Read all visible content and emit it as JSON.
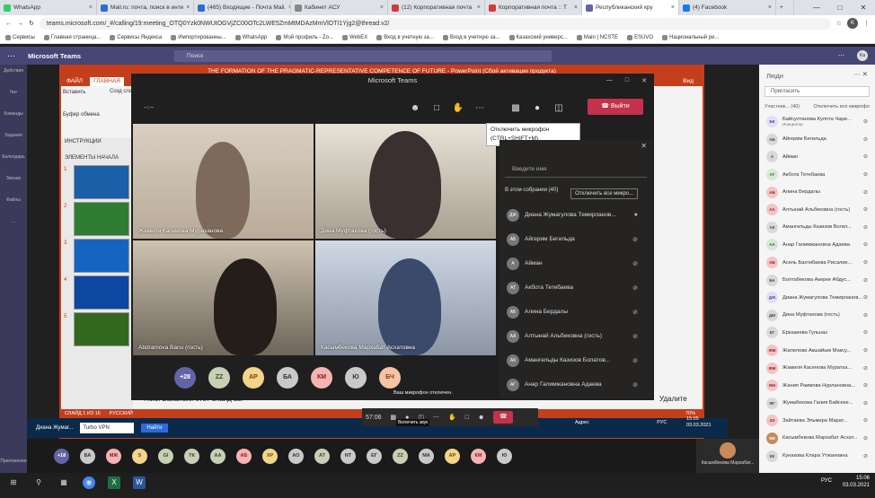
{
  "browser": {
    "tabs": [
      {
        "label": "WhatsApp",
        "color": "#25d366"
      },
      {
        "label": "Mail.ru: почта, поиск в инте",
        "color": "#2d6cd6"
      },
      {
        "label": "(465) Входящие - Почта Mail.",
        "color": "#2d6cd6"
      },
      {
        "label": "Кабинет АСУ",
        "color": "#888888"
      },
      {
        "label": "(12) Корпоративная почта",
        "color": "#d13b3b"
      },
      {
        "label": "Корпоративная почта :: Т",
        "color": "#d13b3b"
      },
      {
        "label": "Республиканский кру",
        "color": "#6264a7"
      },
      {
        "label": "(4) Facebook",
        "color": "#1877f2"
      }
    ],
    "new_tab": "+",
    "url": "teams.microsoft.com/_#/calling/19:meeting_OTQ0Yzk0NWUtOGVjZC00OTc2LWE5ZmMtMDAzMmVlOTI1Yjg2@thread.v2/",
    "profile": "K",
    "bookmarks": [
      "Сервисы",
      "Главная страница...",
      "Сервисы Яндекса",
      "Импортированны...",
      "WhatsApp",
      "Мой профиль - Zo...",
      "WebEX",
      "Вход в учетную за...",
      "Вход в учетную за...",
      "Казахский универс...",
      "Main | NCSTE",
      "ESUVO",
      "Национальный ре..."
    ]
  },
  "teams": {
    "app_name": "Microsoft Teams",
    "search_placeholder": "Поиск",
    "avatar": "Ka",
    "rail": [
      "Действия",
      "Чат",
      "Команды",
      "Задания",
      "Календарь",
      "Звонки",
      "Файлы",
      "..."
    ],
    "rail_bottom": [
      "Приложения",
      "Справка"
    ]
  },
  "ppt": {
    "title": "THE FORMATION OF THE PRAGMATIC-REPRESENTATIVE COMPETENCE OF FUTURE - PowerPoint (Сбой активации продукта)",
    "ribbon": [
      "ФАЙЛ",
      "ГЛАВНАЯ",
      "Вид"
    ],
    "clipboard_labels": [
      "Вставить",
      "Созд слай"
    ],
    "clipboard": "Буфер обмена",
    "sections": [
      "ИНСТРУКЦИИ",
      "ЭЛЕМЕНТЫ НАЧАЛА"
    ],
    "slide_numbers": [
      "1",
      "2",
      "3",
      "4",
      "5"
    ],
    "status_slide": "СЛАЙД 1 ИЗ 16",
    "status_lang": "РУССКИЙ",
    "zoom": "70%",
    "notes_left": "Поки Вакансии этот слайд вы",
    "notes_right": "Удалите",
    "time": "15:05",
    "date": "03.03.2021"
  },
  "meeting": {
    "title": "Microsoft Teams",
    "timer": "--:--",
    "leave_label": "Выйти",
    "tooltip_line1": "Отключить микрофон",
    "tooltip_line2": "(CTRL+SHIFT+M)",
    "video_tiles": [
      {
        "name": "Жамиля Касенова Мураханова"
      },
      {
        "name": "Дина Муфтахова (гость)"
      },
      {
        "name": "Abdramova Banu (гость)"
      },
      {
        "name": "Касымбекова Мархабат Асхатовна"
      }
    ],
    "overflow": [
      {
        "label": "+28",
        "bg": "#6264a7",
        "fg": "#ffffff"
      },
      {
        "label": "ZZ",
        "bg": "#c8cfb5",
        "fg": "#3b4a1e"
      },
      {
        "label": "АР",
        "bg": "#f2d48a",
        "fg": "#6b4a00"
      },
      {
        "label": "БА",
        "bg": "#c9c9c9",
        "fg": "#333333"
      },
      {
        "label": "КМ",
        "bg": "#f4b4b4",
        "fg": "#8a1d1d"
      },
      {
        "label": "Ю",
        "bg": "#c9c9c9",
        "fg": "#333333"
      },
      {
        "label": "БЧ",
        "bg": "#f4c4a4",
        "fg": "#8a3d00"
      }
    ],
    "mic_muted_text": "Ваш микрофон отключен.",
    "turn_on_sound": "Включить звук",
    "participants": {
      "search_placeholder": "Введите имя",
      "section": "В этом собрании (40)",
      "mute_all": "Отключить все микро...",
      "people": [
        {
          "initials": "ДЖ",
          "name": "Диана Жумагулова Темирланов..."
        },
        {
          "initials": "АБ",
          "name": "Айгерим Бегильда"
        },
        {
          "initials": "А",
          "name": "Айман"
        },
        {
          "initials": "АТ",
          "name": "Акбота Тетебаева"
        },
        {
          "initials": "АБ",
          "name": "Алина Бердалы"
        },
        {
          "initials": "АА",
          "name": "Алтынай Альбековна (гость)"
        },
        {
          "initials": "АК",
          "name": "Амангельды Казизов Болатов..."
        },
        {
          "initials": "АГ",
          "name": "Анар Галимжановна Адаева"
        }
      ]
    }
  },
  "people_panel": {
    "title": "Люди",
    "invite": "Пригласить",
    "sub": "Участник... (40)",
    "mute_all": "Отключить все микрофо",
    "people": [
      {
        "initials": "БК",
        "name": "Байсултанова Кулпта Чари...",
        "role": "Инициатор",
        "bg": "#e1dff5",
        "fg": "#4b3f9c"
      },
      {
        "initials": "АБ",
        "name": "Айгерим Бегильда",
        "role": "",
        "bg": "#d9d9d9",
        "fg": "#444444"
      },
      {
        "initials": "А",
        "name": "Айман",
        "role": "",
        "bg": "#d9d9d9",
        "fg": "#444444"
      },
      {
        "initials": "АТ",
        "name": "Акбота Тетебаева",
        "role": "",
        "bg": "#d6e9d6",
        "fg": "#2b6a2b"
      },
      {
        "initials": "АБ",
        "name": "Алина Бердалы",
        "role": "",
        "bg": "#f4c4c4",
        "fg": "#8a1d1d"
      },
      {
        "initials": "АА",
        "name": "Алтынай Альбековна (гость)",
        "role": "",
        "bg": "#f4c4c4",
        "fg": "#8a1d1d"
      },
      {
        "initials": "АК",
        "name": "Амангельды Казизов Болат...",
        "role": "",
        "bg": "#d9d9d9",
        "fg": "#444444"
      },
      {
        "initials": "АА",
        "name": "Анар Галимжановна Адаева",
        "role": "",
        "bg": "#d6e9d6",
        "fg": "#2b6a2b"
      },
      {
        "initials": "АБ",
        "name": "Асель Бахтибаева Рисалие...",
        "role": "",
        "bg": "#f4c4c4",
        "fg": "#8a1d1d"
      },
      {
        "initials": "БА",
        "name": "Болтабекова Акерке Абдус...",
        "role": "",
        "bg": "#d9d9d9",
        "fg": "#444444"
      },
      {
        "initials": "ДЖ",
        "name": "Диана Жумагулова Темирланов...",
        "role": "",
        "bg": "#e1dff5",
        "fg": "#4b3f9c"
      },
      {
        "initials": "ДМ",
        "name": "Дина Муфтахова (гость)",
        "role": "",
        "bg": "#d9d9d9",
        "fg": "#444444"
      },
      {
        "initials": "ЕГ",
        "name": "Ерказиева Гульназ",
        "role": "",
        "bg": "#d9d9d9",
        "fg": "#444444"
      },
      {
        "initials": "ЖМ",
        "name": "Жалелова Акшайым Максу...",
        "role": "",
        "bg": "#f4c4c4",
        "fg": "#8a1d1d"
      },
      {
        "initials": "ЖМ",
        "name": "Жамиля Касенова Муратха...",
        "role": "",
        "bg": "#f4c4c4",
        "fg": "#8a1d1d"
      },
      {
        "initials": "ЖН",
        "name": "Жания Раимова Нурлановна...",
        "role": "",
        "bg": "#f4c4c4",
        "fg": "#8a1d1d"
      },
      {
        "initials": "ЖГ",
        "name": "Жумабекова Галия Байсеке...",
        "role": "",
        "bg": "#d9d9d9",
        "fg": "#444444"
      },
      {
        "initials": "ЗЭ",
        "name": "Зайтаева Эльмира Марат...",
        "role": "",
        "bg": "#f4c4c4",
        "fg": "#8a1d1d"
      },
      {
        "initials": "КМ",
        "name": "Касымбекова Мархабат Асхат...",
        "role": "",
        "bg": "#c98a5a",
        "fg": "#ffffff"
      },
      {
        "initials": "КК",
        "name": "Кунакова Клара Утжановна",
        "role": "",
        "bg": "#d9d9d9",
        "fg": "#444444"
      }
    ]
  },
  "dock": {
    "avatars": [
      {
        "label": "+18",
        "bg": "#6264a7",
        "fg": "#fff"
      },
      {
        "label": "БА",
        "bg": "#c9c9c9",
        "fg": "#333"
      },
      {
        "label": "МЖ",
        "bg": "#f4b4b4",
        "fg": "#8a1d1d"
      },
      {
        "label": "S",
        "bg": "#f2d48a",
        "fg": "#6b4a00"
      },
      {
        "label": "GI",
        "bg": "#c8cfb5",
        "fg": "#3b4a1e"
      },
      {
        "label": "ТК",
        "bg": "#c8cfb5",
        "fg": "#3b4a1e"
      },
      {
        "label": "АА",
        "bg": "#c8cfb5",
        "fg": "#3b4a1e"
      },
      {
        "label": "АБ",
        "bg": "#f4b4b4",
        "fg": "#8a1d1d"
      },
      {
        "label": "ХР",
        "bg": "#f2d48a",
        "fg": "#6b4a00"
      },
      {
        "label": "АО",
        "bg": "#c9c9c9",
        "fg": "#333"
      },
      {
        "label": "АТ",
        "bg": "#c8cfb5",
        "fg": "#3b4a1e"
      },
      {
        "label": "NT",
        "bg": "#c9c9c9",
        "fg": "#333"
      },
      {
        "label": "ЕГ",
        "bg": "#c9c9c9",
        "fg": "#333"
      },
      {
        "label": "ZZ",
        "bg": "#c8cfb5",
        "fg": "#3b4a1e"
      },
      {
        "label": "МА",
        "bg": "#c9c9c9",
        "fg": "#333"
      },
      {
        "label": "АР",
        "bg": "#f2d48a",
        "fg": "#6b4a00"
      },
      {
        "label": "КМ",
        "bg": "#f4b4b4",
        "fg": "#8a1d1d"
      },
      {
        "label": "Ю",
        "bg": "#c9c9c9",
        "fg": "#333"
      }
    ],
    "last_name": "Касымбекова Мархабат...",
    "first_name": "Диана Жумаг..."
  },
  "ppt_taskbar": {
    "search": "Turbo VPN",
    "find": "Найти",
    "address": "Адрес",
    "lang": "РУС"
  },
  "meeting_controls": {
    "timer": "57:06",
    "mute_tip": "Включить звук"
  },
  "win_taskbar": {
    "lang": "РУС",
    "time": "15:06",
    "date": "03.03.2021"
  }
}
